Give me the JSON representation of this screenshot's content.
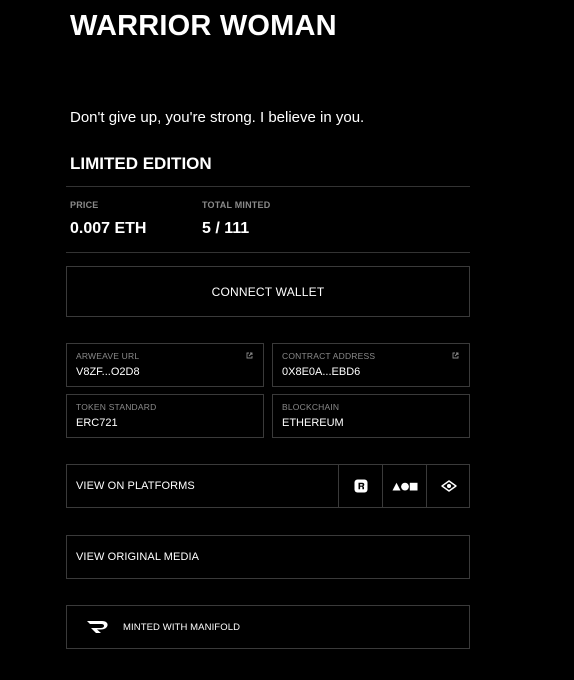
{
  "token": {
    "title": "WARRIOR WOMAN",
    "description": "Don't give up, you're strong. I believe in you.",
    "edition": "LIMITED EDITION"
  },
  "stats": {
    "price_label": "PRICE",
    "price_value": "0.007 ETH",
    "minted_label": "TOTAL MINTED",
    "minted_value": "5 / 111"
  },
  "actions": {
    "connect_wallet": "CONNECT WALLET",
    "view_on_platforms": "VIEW ON PLATFORMS",
    "view_original_media": "VIEW ORIGINAL MEDIA",
    "minted_with": "MINTED WITH MANIFOLD"
  },
  "details": {
    "arweave_label": "ARWEAVE URL",
    "arweave_value": "V8ZF...O2D8",
    "contract_label": "CONTRACT ADDRESS",
    "contract_value": "0X8E0A...EBD6",
    "standard_label": "TOKEN STANDARD",
    "standard_value": "ERC721",
    "chain_label": "BLOCKCHAIN",
    "chain_value": "ETHEREUM"
  },
  "platforms": [
    {
      "icon": "rarible-icon"
    },
    {
      "icon": "foundation-icon"
    },
    {
      "icon": "eye-icon"
    }
  ],
  "colors": {
    "background": "#000000",
    "text": "#ffffff",
    "muted": "#8a8a8a",
    "border": "#3a3a3a"
  }
}
